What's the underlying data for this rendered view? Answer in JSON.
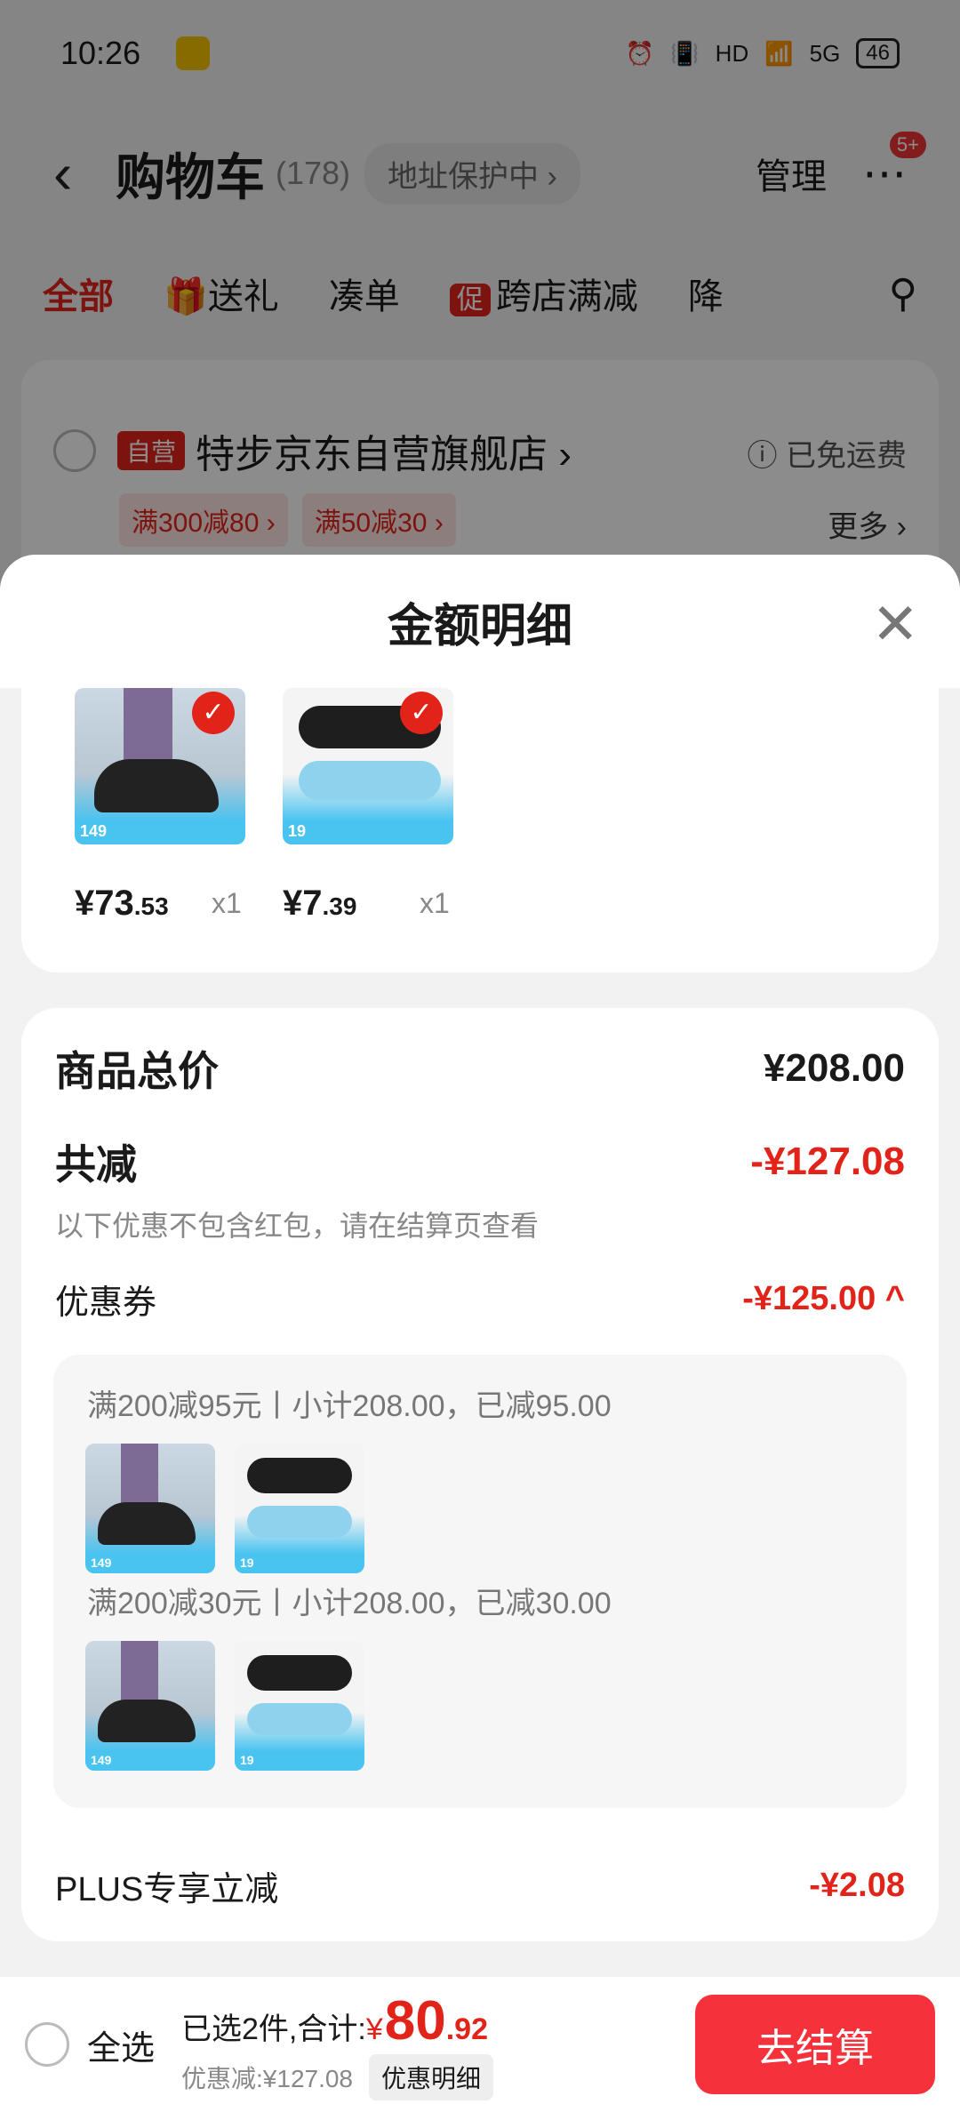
{
  "status": {
    "time": "10:26",
    "network": "5G",
    "hd": "HD",
    "battery": "46"
  },
  "cart": {
    "title": "购物车",
    "count": "(178)",
    "address_protect": "地址保护中 ›",
    "manage": "管理",
    "more_badge": "5+"
  },
  "tabs": [
    "全部",
    "送礼",
    "凑单",
    "跨店满减",
    "降"
  ],
  "tab_promo_badge": "促",
  "store": {
    "self_badge": "自营",
    "name": "特步京东自营旗舰店 ›",
    "free_ship": "ⓘ 已免运费",
    "promos": [
      "满300减80 ›",
      "满50减30 ›"
    ],
    "more": "更多 ›"
  },
  "sheet": {
    "title": "金额明细",
    "close_icon": "close-icon"
  },
  "goods": [
    {
      "price_main": "¥73",
      "price_cents": ".53",
      "qty": "x1",
      "img_price": "149"
    },
    {
      "price_main": "¥7",
      "price_cents": ".39",
      "qty": "x1",
      "img_price": "19"
    }
  ],
  "summary": {
    "total_label": "商品总价",
    "total_value": "¥208.00",
    "reduce_label": "共减",
    "reduce_value": "-¥127.08",
    "reduce_note": "以下优惠不包含红包，请在结算页查看",
    "coupon_label": "优惠券",
    "coupon_value": "-¥125.00 ^",
    "coupon_lines": [
      "满200减95元丨小计208.00，已减95.00",
      "满200减30元丨小计208.00，已减30.00"
    ],
    "plus_label": "PLUS专享立减",
    "plus_value": "-¥2.08"
  },
  "bottom": {
    "select_all": "全选",
    "selected_text": "已选2件,合计:",
    "yen": "¥",
    "amount": "80",
    "cents": ".92",
    "discount": "优惠减:¥127.08",
    "detail": "优惠明细",
    "checkout": "去结算"
  },
  "colors": {
    "accent": "#e2231a",
    "checkout": "#f5323c"
  }
}
